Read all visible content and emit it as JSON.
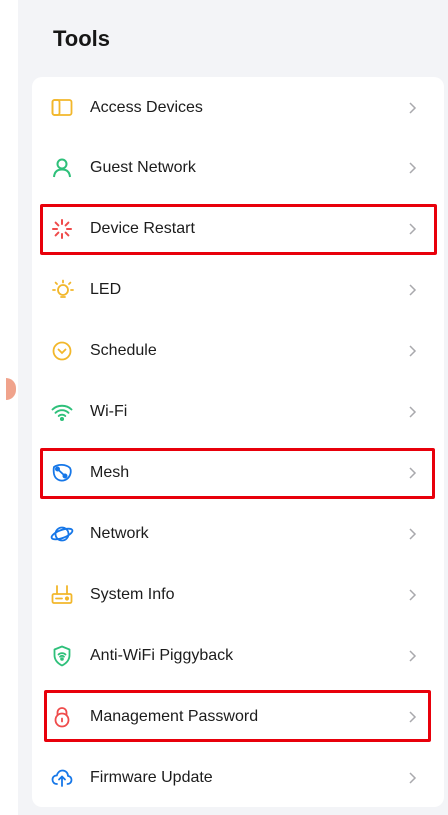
{
  "header": {
    "title": "Tools"
  },
  "menu": {
    "items": [
      {
        "label": "Access Devices",
        "icon": "access-devices-icon"
      },
      {
        "label": "Guest Network",
        "icon": "guest-icon"
      },
      {
        "label": "Device Restart",
        "icon": "restart-icon"
      },
      {
        "label": "LED",
        "icon": "led-icon"
      },
      {
        "label": "Schedule",
        "icon": "schedule-icon"
      },
      {
        "label": "Wi-Fi",
        "icon": "wifi-icon"
      },
      {
        "label": "Mesh",
        "icon": "mesh-icon"
      },
      {
        "label": "Network",
        "icon": "network-icon"
      },
      {
        "label": "System Info",
        "icon": "system-info-icon"
      },
      {
        "label": "Anti-WiFi Piggyback",
        "icon": "shield-wifi-icon"
      },
      {
        "label": "Management Password",
        "icon": "lock-icon"
      },
      {
        "label": "Firmware Update",
        "icon": "cloud-upload-icon"
      }
    ]
  },
  "colors": {
    "highlight": "#e8000b",
    "accent_yellow": "#f2b72b",
    "accent_green": "#2ec07a",
    "accent_blue": "#1677e8",
    "accent_red": "#ef4b4b"
  }
}
